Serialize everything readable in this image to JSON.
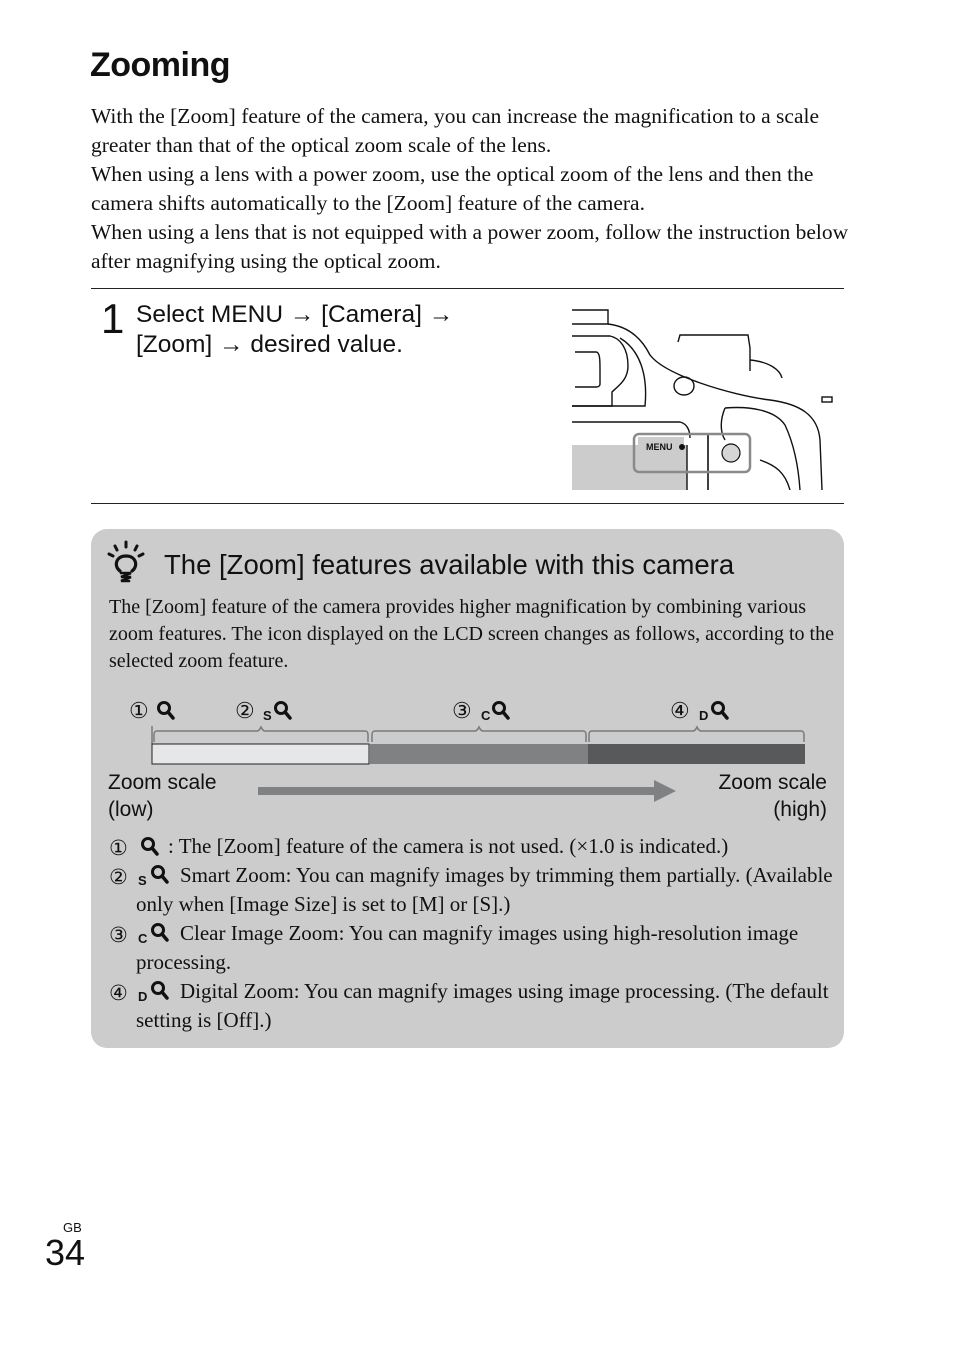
{
  "page": {
    "title": "Zooming",
    "intro_paragraphs": [
      "With the [Zoom] feature of the camera, you can increase the magnification to a scale greater than that of the optical zoom scale of the lens.",
      "When using a lens with a power zoom, use the optical zoom of the lens and then the camera shifts automatically to the [Zoom] feature of the camera.",
      "When using a lens that is not equipped with a power zoom, follow the instruction below after magnifying using the optical zoom."
    ],
    "step": {
      "number": "1",
      "line1": "Select MENU → [Camera] →",
      "line2": "[Zoom] → desired value."
    },
    "camera_illustration": {
      "button_label": "MENU",
      "icon": "camera-back-illustration"
    },
    "tip": {
      "icon": "lightbulb-hint-icon",
      "heading": "The [Zoom] features available with this camera",
      "text": "The [Zoom] feature of the camera provides higher magnification by combining various zoom features. The icon displayed on the LCD screen changes as follows, according to the selected zoom feature.",
      "scale": {
        "markers": [
          {
            "num": "①",
            "prefix": ""
          },
          {
            "num": "②",
            "prefix": "S"
          },
          {
            "num": "③",
            "prefix": "C"
          },
          {
            "num": "④",
            "prefix": "D"
          }
        ],
        "low_line1": "Zoom scale",
        "low_line2": "(low)",
        "high_line1": "Zoom scale",
        "high_line2": "(high)",
        "colors": {
          "segment1": "#e6e7e9",
          "segment2": "#808183",
          "segment3": "#58595b",
          "arrow": "#808183",
          "bracket": "#7a7a7a"
        }
      },
      "legend": [
        {
          "num": "①",
          "prefix": "",
          "text": ": The [Zoom] feature of the camera is not used. (×1.0 is indicated.)"
        },
        {
          "num": "②",
          "prefix": "S",
          "text": "Smart Zoom: You can magnify images by trimming them partially. (Available only when [Image Size] is set to [M] or [S].)"
        },
        {
          "num": "③",
          "prefix": "C",
          "text": "Clear Image Zoom: You can magnify images using high-resolution image processing."
        },
        {
          "num": "④",
          "prefix": "D",
          "text": "Digital Zoom: You can magnify images using image processing. (The default setting is [Off].)"
        }
      ]
    },
    "footer": {
      "lang": "GB",
      "page_number": "34"
    }
  }
}
